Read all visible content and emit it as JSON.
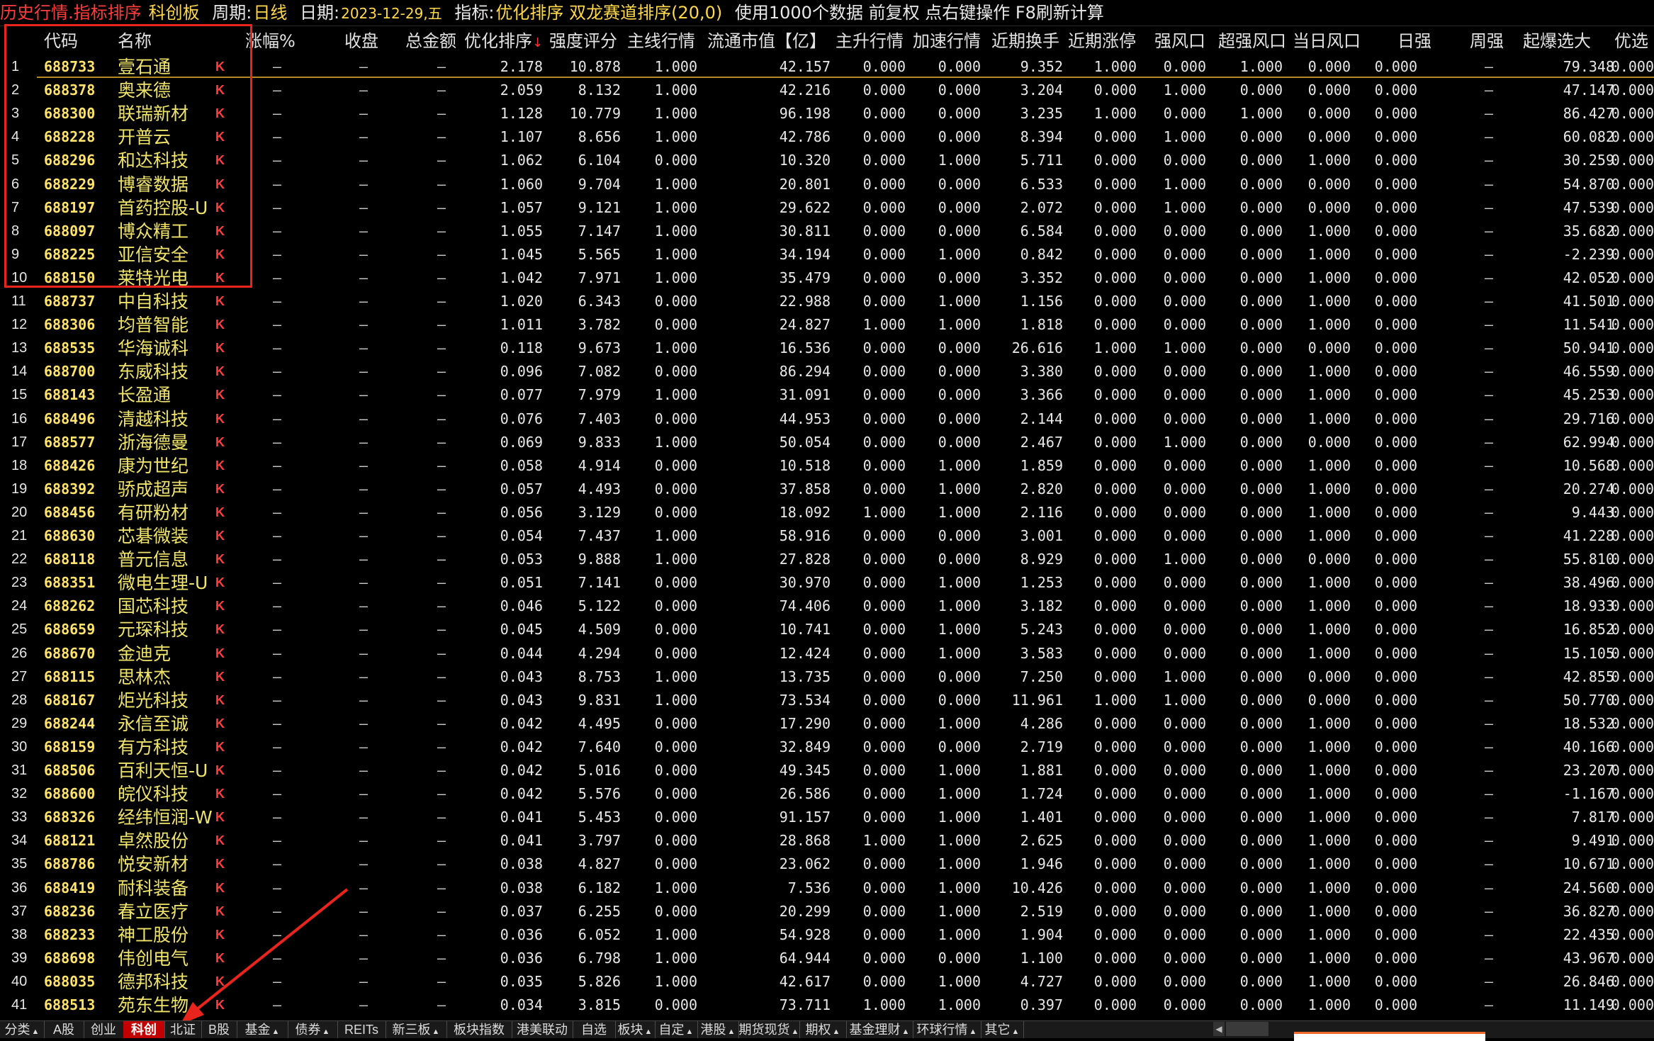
{
  "topbar": {
    "title": "历史行情.指标排序",
    "board": "科创板",
    "period_label": "周期:",
    "period_value": "日线",
    "date_label": "日期:",
    "date_value": "2023-12-29,五",
    "indicator_label": "指标:",
    "indicator_value": "优化排序 双龙赛道排序(20,0)",
    "note": "使用1000个数据 前复权 点右键操作 F8刷新计算"
  },
  "columns": [
    {
      "key": "code",
      "label": "代码"
    },
    {
      "key": "name",
      "label": "名称"
    },
    {
      "key": "chg",
      "label": "涨幅%"
    },
    {
      "key": "close",
      "label": "收盘"
    },
    {
      "key": "amount",
      "label": "总金额"
    },
    {
      "key": "opt",
      "label": "优化排序"
    },
    {
      "key": "strength",
      "label": "强度评分"
    },
    {
      "key": "main",
      "label": "主线行情"
    },
    {
      "key": "mcap",
      "label": "流通市值【亿】"
    },
    {
      "key": "up",
      "label": "主升行情"
    },
    {
      "key": "accel",
      "label": "加速行情"
    },
    {
      "key": "turnover",
      "label": "近期换手"
    },
    {
      "key": "limitup",
      "label": "近期涨停"
    },
    {
      "key": "wind",
      "label": "强风口"
    },
    {
      "key": "superwind",
      "label": "超强风口"
    },
    {
      "key": "daywind",
      "label": "当日风口"
    },
    {
      "key": "dstrong",
      "label": "日强"
    },
    {
      "key": "wstrong",
      "label": "周强"
    },
    {
      "key": "boom",
      "label": "起爆选大"
    },
    {
      "key": "pick",
      "label": "优选"
    }
  ],
  "dash": "–",
  "k_label": "K",
  "rows": [
    [
      "1",
      "688733",
      "壹石通",
      "2.178",
      "10.878",
      "1.000",
      "42.157",
      "0.000",
      "0.000",
      "9.352",
      "1.000",
      "0.000",
      "1.000",
      "0.000",
      "0.000",
      "79.348",
      "0.000"
    ],
    [
      "2",
      "688378",
      "奥来德",
      "2.059",
      "8.132",
      "1.000",
      "42.216",
      "0.000",
      "0.000",
      "3.204",
      "0.000",
      "1.000",
      "0.000",
      "0.000",
      "0.000",
      "47.147",
      "0.000"
    ],
    [
      "3",
      "688300",
      "联瑞新材",
      "1.128",
      "10.779",
      "1.000",
      "96.198",
      "0.000",
      "0.000",
      "3.235",
      "1.000",
      "0.000",
      "1.000",
      "0.000",
      "0.000",
      "86.427",
      "0.000"
    ],
    [
      "4",
      "688228",
      "开普云",
      "1.107",
      "8.656",
      "1.000",
      "42.786",
      "0.000",
      "0.000",
      "8.394",
      "0.000",
      "1.000",
      "0.000",
      "0.000",
      "0.000",
      "60.082",
      "0.000"
    ],
    [
      "5",
      "688296",
      "和达科技",
      "1.062",
      "6.104",
      "0.000",
      "10.320",
      "0.000",
      "1.000",
      "5.711",
      "0.000",
      "0.000",
      "0.000",
      "1.000",
      "0.000",
      "30.259",
      "0.000"
    ],
    [
      "6",
      "688229",
      "博睿数据",
      "1.060",
      "9.704",
      "1.000",
      "20.801",
      "0.000",
      "0.000",
      "6.533",
      "0.000",
      "1.000",
      "0.000",
      "0.000",
      "0.000",
      "54.870",
      "0.000"
    ],
    [
      "7",
      "688197",
      "首药控股-U",
      "1.057",
      "9.121",
      "1.000",
      "29.622",
      "0.000",
      "0.000",
      "2.072",
      "0.000",
      "1.000",
      "0.000",
      "0.000",
      "0.000",
      "47.539",
      "0.000"
    ],
    [
      "8",
      "688097",
      "博众精工",
      "1.055",
      "7.147",
      "1.000",
      "30.811",
      "0.000",
      "0.000",
      "6.584",
      "0.000",
      "0.000",
      "0.000",
      "1.000",
      "0.000",
      "35.682",
      "0.000"
    ],
    [
      "9",
      "688225",
      "亚信安全",
      "1.045",
      "5.565",
      "1.000",
      "34.194",
      "0.000",
      "1.000",
      "0.842",
      "0.000",
      "0.000",
      "0.000",
      "1.000",
      "0.000",
      "-2.239",
      "0.000"
    ],
    [
      "10",
      "688150",
      "莱特光电",
      "1.042",
      "7.971",
      "1.000",
      "35.479",
      "0.000",
      "0.000",
      "3.352",
      "0.000",
      "0.000",
      "0.000",
      "1.000",
      "0.000",
      "42.052",
      "0.000"
    ],
    [
      "11",
      "688737",
      "中自科技",
      "1.020",
      "6.343",
      "0.000",
      "22.988",
      "0.000",
      "1.000",
      "1.156",
      "0.000",
      "0.000",
      "0.000",
      "1.000",
      "0.000",
      "41.501",
      "0.000"
    ],
    [
      "12",
      "688306",
      "均普智能",
      "1.011",
      "3.782",
      "0.000",
      "24.827",
      "1.000",
      "1.000",
      "1.818",
      "0.000",
      "0.000",
      "0.000",
      "1.000",
      "0.000",
      "11.541",
      "0.000"
    ],
    [
      "13",
      "688535",
      "华海诚科",
      "0.118",
      "9.673",
      "1.000",
      "16.536",
      "0.000",
      "0.000",
      "26.616",
      "1.000",
      "1.000",
      "0.000",
      "0.000",
      "0.000",
      "50.941",
      "0.000"
    ],
    [
      "14",
      "688700",
      "东威科技",
      "0.096",
      "7.082",
      "0.000",
      "86.294",
      "0.000",
      "0.000",
      "3.380",
      "0.000",
      "0.000",
      "0.000",
      "1.000",
      "0.000",
      "46.559",
      "0.000"
    ],
    [
      "15",
      "688143",
      "长盈通",
      "0.077",
      "7.979",
      "1.000",
      "31.091",
      "0.000",
      "0.000",
      "3.366",
      "0.000",
      "0.000",
      "0.000",
      "1.000",
      "0.000",
      "45.253",
      "0.000"
    ],
    [
      "16",
      "688496",
      "清越科技",
      "0.076",
      "7.403",
      "0.000",
      "44.953",
      "0.000",
      "0.000",
      "2.144",
      "0.000",
      "0.000",
      "0.000",
      "1.000",
      "0.000",
      "29.716",
      "0.000"
    ],
    [
      "17",
      "688577",
      "浙海德曼",
      "0.069",
      "9.833",
      "1.000",
      "50.054",
      "0.000",
      "0.000",
      "2.467",
      "0.000",
      "1.000",
      "0.000",
      "0.000",
      "0.000",
      "62.994",
      "0.000"
    ],
    [
      "18",
      "688426",
      "康为世纪",
      "0.058",
      "4.914",
      "0.000",
      "10.518",
      "0.000",
      "1.000",
      "1.859",
      "0.000",
      "0.000",
      "0.000",
      "1.000",
      "0.000",
      "10.568",
      "0.000"
    ],
    [
      "19",
      "688392",
      "骄成超声",
      "0.057",
      "4.493",
      "0.000",
      "37.858",
      "0.000",
      "1.000",
      "2.820",
      "0.000",
      "0.000",
      "0.000",
      "1.000",
      "0.000",
      "20.274",
      "0.000"
    ],
    [
      "20",
      "688456",
      "有研粉材",
      "0.056",
      "3.129",
      "0.000",
      "18.092",
      "1.000",
      "1.000",
      "2.116",
      "0.000",
      "0.000",
      "0.000",
      "1.000",
      "0.000",
      "9.443",
      "0.000"
    ],
    [
      "21",
      "688630",
      "芯碁微装",
      "0.054",
      "7.437",
      "1.000",
      "58.916",
      "0.000",
      "0.000",
      "3.001",
      "0.000",
      "0.000",
      "0.000",
      "1.000",
      "0.000",
      "41.228",
      "0.000"
    ],
    [
      "22",
      "688118",
      "普元信息",
      "0.053",
      "9.888",
      "1.000",
      "27.828",
      "0.000",
      "0.000",
      "8.929",
      "0.000",
      "1.000",
      "0.000",
      "0.000",
      "0.000",
      "55.810",
      "0.000"
    ],
    [
      "23",
      "688351",
      "微电生理-U",
      "0.051",
      "7.141",
      "0.000",
      "30.970",
      "0.000",
      "1.000",
      "1.253",
      "0.000",
      "0.000",
      "0.000",
      "1.000",
      "0.000",
      "38.496",
      "0.000"
    ],
    [
      "24",
      "688262",
      "国芯科技",
      "0.046",
      "5.122",
      "0.000",
      "74.406",
      "0.000",
      "1.000",
      "3.182",
      "0.000",
      "0.000",
      "0.000",
      "1.000",
      "0.000",
      "18.933",
      "0.000"
    ],
    [
      "25",
      "688659",
      "元琛科技",
      "0.045",
      "4.509",
      "0.000",
      "10.741",
      "0.000",
      "1.000",
      "5.243",
      "0.000",
      "0.000",
      "0.000",
      "1.000",
      "0.000",
      "16.852",
      "0.000"
    ],
    [
      "26",
      "688670",
      "金迪克",
      "0.044",
      "4.294",
      "0.000",
      "12.424",
      "0.000",
      "1.000",
      "3.583",
      "0.000",
      "0.000",
      "0.000",
      "1.000",
      "0.000",
      "15.105",
      "0.000"
    ],
    [
      "27",
      "688115",
      "思林杰",
      "0.043",
      "8.753",
      "1.000",
      "13.735",
      "0.000",
      "0.000",
      "7.250",
      "0.000",
      "1.000",
      "0.000",
      "0.000",
      "0.000",
      "42.855",
      "0.000"
    ],
    [
      "28",
      "688167",
      "炬光科技",
      "0.043",
      "9.831",
      "1.000",
      "73.534",
      "0.000",
      "0.000",
      "11.961",
      "1.000",
      "1.000",
      "0.000",
      "0.000",
      "0.000",
      "50.770",
      "0.000"
    ],
    [
      "29",
      "688244",
      "永信至诚",
      "0.042",
      "4.495",
      "0.000",
      "17.290",
      "0.000",
      "1.000",
      "4.286",
      "0.000",
      "0.000",
      "0.000",
      "1.000",
      "0.000",
      "18.532",
      "0.000"
    ],
    [
      "30",
      "688159",
      "有方科技",
      "0.042",
      "7.640",
      "0.000",
      "32.849",
      "0.000",
      "0.000",
      "2.719",
      "0.000",
      "0.000",
      "0.000",
      "1.000",
      "0.000",
      "40.166",
      "0.000"
    ],
    [
      "31",
      "688506",
      "百利天恒-U",
      "0.042",
      "5.016",
      "0.000",
      "49.345",
      "0.000",
      "1.000",
      "1.881",
      "0.000",
      "0.000",
      "0.000",
      "1.000",
      "0.000",
      "23.207",
      "0.000"
    ],
    [
      "32",
      "688600",
      "皖仪科技",
      "0.042",
      "5.576",
      "0.000",
      "26.586",
      "0.000",
      "1.000",
      "1.724",
      "0.000",
      "0.000",
      "0.000",
      "1.000",
      "0.000",
      "-1.167",
      "0.000"
    ],
    [
      "33",
      "688326",
      "经纬恒润-W",
      "0.041",
      "5.453",
      "0.000",
      "91.157",
      "0.000",
      "1.000",
      "1.401",
      "0.000",
      "0.000",
      "0.000",
      "1.000",
      "0.000",
      "7.817",
      "0.000"
    ],
    [
      "34",
      "688121",
      "卓然股份",
      "0.041",
      "3.797",
      "0.000",
      "28.868",
      "1.000",
      "1.000",
      "2.625",
      "0.000",
      "0.000",
      "0.000",
      "1.000",
      "0.000",
      "9.491",
      "0.000"
    ],
    [
      "35",
      "688786",
      "悦安新材",
      "0.038",
      "4.827",
      "0.000",
      "23.062",
      "0.000",
      "1.000",
      "1.946",
      "0.000",
      "0.000",
      "0.000",
      "1.000",
      "0.000",
      "10.671",
      "0.000"
    ],
    [
      "36",
      "688419",
      "耐科装备",
      "0.038",
      "6.182",
      "1.000",
      "7.536",
      "0.000",
      "1.000",
      "10.426",
      "0.000",
      "0.000",
      "0.000",
      "1.000",
      "0.000",
      "24.560",
      "0.000"
    ],
    [
      "37",
      "688236",
      "春立医疗",
      "0.037",
      "6.255",
      "0.000",
      "20.299",
      "0.000",
      "1.000",
      "2.519",
      "0.000",
      "0.000",
      "0.000",
      "1.000",
      "0.000",
      "36.827",
      "0.000"
    ],
    [
      "38",
      "688233",
      "神工股份",
      "0.036",
      "6.052",
      "1.000",
      "54.928",
      "0.000",
      "1.000",
      "1.904",
      "0.000",
      "0.000",
      "0.000",
      "1.000",
      "0.000",
      "22.435",
      "0.000"
    ],
    [
      "39",
      "688698",
      "伟创电气",
      "0.036",
      "6.798",
      "1.000",
      "64.944",
      "0.000",
      "0.000",
      "1.100",
      "0.000",
      "0.000",
      "0.000",
      "1.000",
      "0.000",
      "43.967",
      "0.000"
    ],
    [
      "40",
      "688035",
      "德邦科技",
      "0.035",
      "5.826",
      "1.000",
      "42.617",
      "0.000",
      "1.000",
      "4.727",
      "0.000",
      "0.000",
      "0.000",
      "1.000",
      "0.000",
      "26.846",
      "0.000"
    ],
    [
      "41",
      "688513",
      "苑东生物",
      "0.034",
      "3.815",
      "0.000",
      "73.711",
      "1.000",
      "1.000",
      "0.397",
      "0.000",
      "0.000",
      "0.000",
      "1.000",
      "0.000",
      "11.149",
      "0.000"
    ]
  ],
  "tabs": [
    {
      "label": "分类",
      "arrow": "▲",
      "active": false
    },
    {
      "label": "A股",
      "arrow": "",
      "active": false
    },
    {
      "label": "创业",
      "arrow": "",
      "active": false
    },
    {
      "label": "科创",
      "arrow": "",
      "active": true
    },
    {
      "label": "北证",
      "arrow": "",
      "active": false
    },
    {
      "label": "B股",
      "arrow": "",
      "active": false
    },
    {
      "label": "基金",
      "arrow": "▲",
      "active": false
    },
    {
      "label": "债券",
      "arrow": "▲",
      "active": false
    },
    {
      "label": "REITs",
      "arrow": "",
      "active": false
    },
    {
      "label": "新三板",
      "arrow": "▲",
      "active": false
    },
    {
      "label": "板块指数",
      "arrow": "",
      "active": false
    },
    {
      "label": "港美联动",
      "arrow": "",
      "active": false
    },
    {
      "label": "自选",
      "arrow": "",
      "active": false
    },
    {
      "label": "板块",
      "arrow": "▲",
      "active": false
    },
    {
      "label": "自定",
      "arrow": "▲",
      "active": false
    },
    {
      "label": "港股",
      "arrow": "▲",
      "active": false
    },
    {
      "label": "期货现货",
      "arrow": "▲",
      "active": false
    },
    {
      "label": "期权",
      "arrow": "▲",
      "active": false
    },
    {
      "label": "基金理财",
      "arrow": "▲",
      "active": false
    },
    {
      "label": "环球行情",
      "arrow": "▲",
      "active": false
    },
    {
      "label": "其它",
      "arrow": "▲",
      "active": false
    }
  ],
  "colors": {
    "highlight_box": "#e8241c",
    "active_tab": "#c30000",
    "code_text": "#ffe36b",
    "k_marker": "#ff3d3d"
  }
}
